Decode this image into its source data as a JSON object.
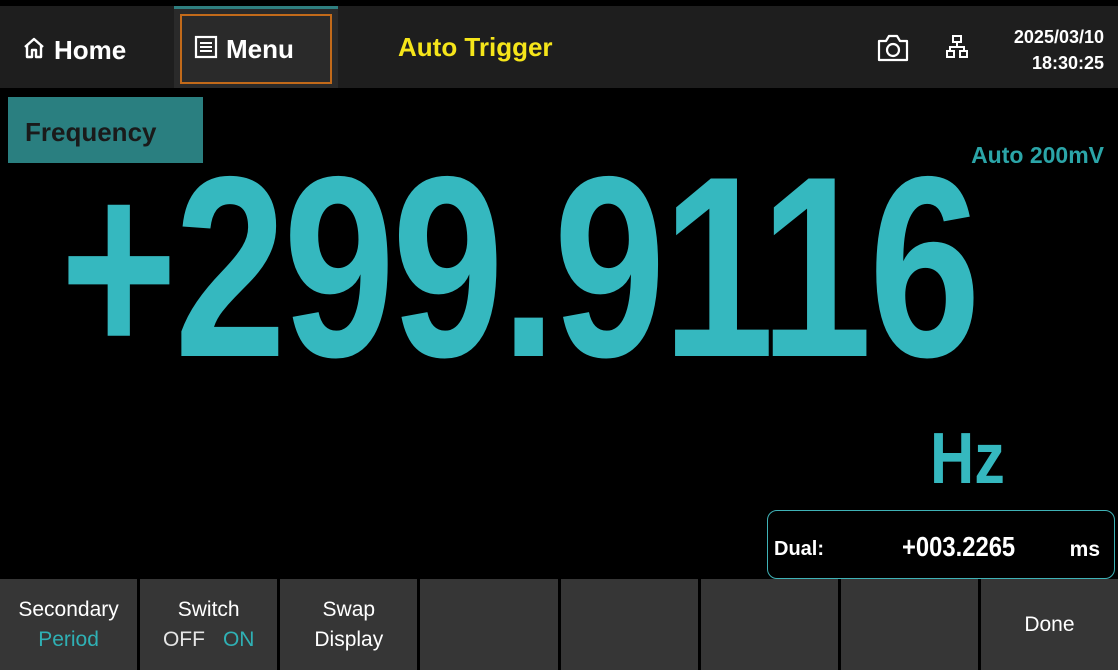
{
  "topbar": {
    "home_label": "Home",
    "menu_label": "Menu",
    "trigger_mode": "Auto Trigger",
    "date": "2025/03/10",
    "time": "18:30:25"
  },
  "display": {
    "function": "Frequency",
    "range": "Auto 200mV",
    "reading": "+299.9116",
    "unit": "Hz",
    "dual_label": "Dual:",
    "dual_value": "+003.2265",
    "dual_unit": "ms"
  },
  "softkeys": {
    "secondary_title": "Secondary",
    "secondary_value": "Period",
    "switch_title": "Switch",
    "switch_off": "OFF",
    "switch_on": "ON",
    "swap_line1": "Swap",
    "swap_line2": "Display",
    "done": "Done"
  },
  "colors": {
    "accent": "#35b8bf",
    "trigger": "#f5e51a",
    "focus_border": "#c26a1a"
  }
}
